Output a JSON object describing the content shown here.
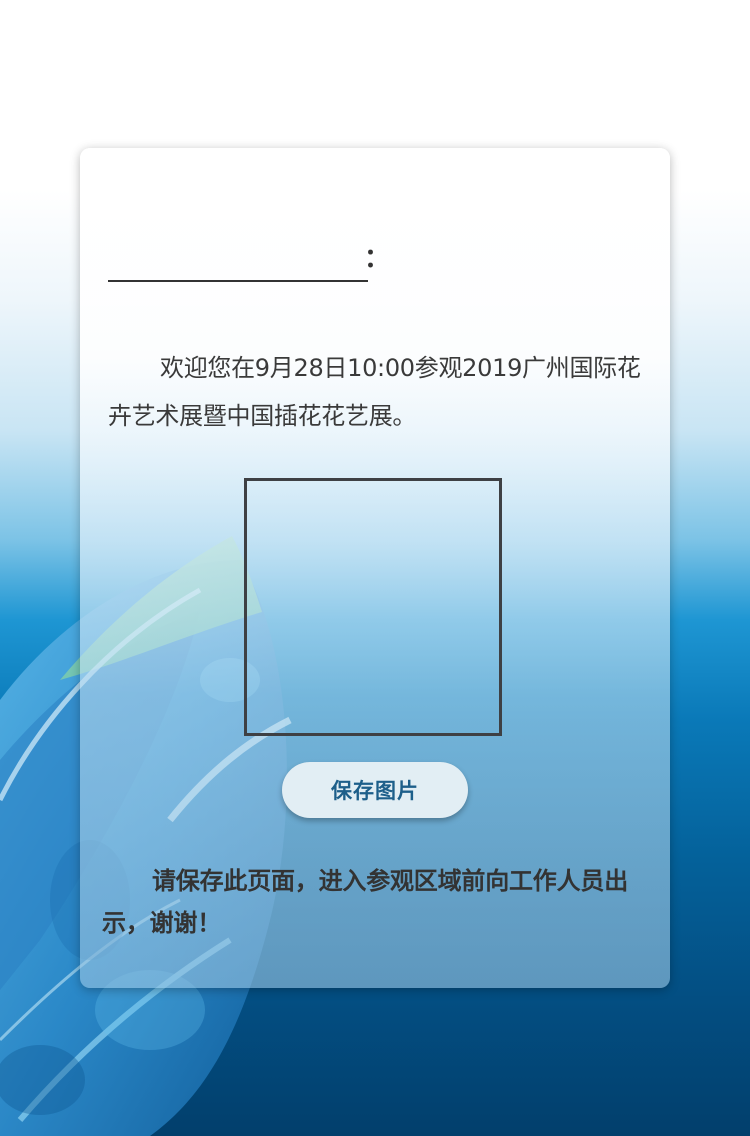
{
  "page": {
    "name_colon": "：",
    "welcome_text": "欢迎您在9月28日10:00参观2019广州国际花卉艺术展暨中国插花花艺展。",
    "save_button_label": "保存图片",
    "notice_text": "请保存此页面，进入参观区域前向工作人员出示，谢谢！"
  },
  "colors": {
    "button_text": "#1d5f8a",
    "text": "#333333",
    "accent_blue": "#1e96d3"
  }
}
